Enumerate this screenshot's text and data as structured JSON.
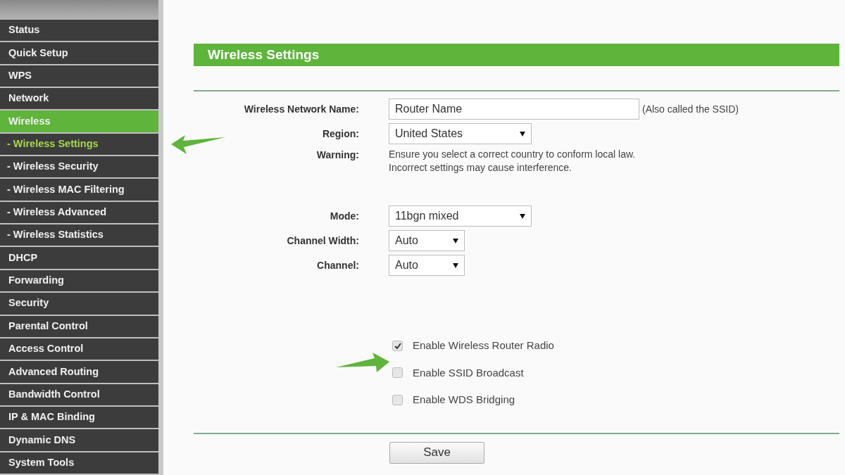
{
  "sidebar": {
    "items": [
      {
        "label": "Status",
        "kind": "main",
        "selected": false
      },
      {
        "label": "Quick Setup",
        "kind": "main",
        "selected": false
      },
      {
        "label": "WPS",
        "kind": "main",
        "selected": false
      },
      {
        "label": "Network",
        "kind": "main",
        "selected": false
      },
      {
        "label": "Wireless",
        "kind": "main",
        "selected": true
      },
      {
        "label": "- Wireless Settings",
        "kind": "sub",
        "selected": true
      },
      {
        "label": "- Wireless Security",
        "kind": "sub",
        "selected": false
      },
      {
        "label": "- Wireless MAC Filtering",
        "kind": "sub",
        "selected": false
      },
      {
        "label": "- Wireless Advanced",
        "kind": "sub",
        "selected": false
      },
      {
        "label": "- Wireless Statistics",
        "kind": "sub",
        "selected": false
      },
      {
        "label": "DHCP",
        "kind": "main",
        "selected": false
      },
      {
        "label": "Forwarding",
        "kind": "main",
        "selected": false
      },
      {
        "label": "Security",
        "kind": "main",
        "selected": false
      },
      {
        "label": "Parental Control",
        "kind": "main",
        "selected": false
      },
      {
        "label": "Access Control",
        "kind": "main",
        "selected": false
      },
      {
        "label": "Advanced Routing",
        "kind": "main",
        "selected": false
      },
      {
        "label": "Bandwidth Control",
        "kind": "main",
        "selected": false
      },
      {
        "label": "IP & MAC Binding",
        "kind": "main",
        "selected": false
      },
      {
        "label": "Dynamic DNS",
        "kind": "main",
        "selected": false
      },
      {
        "label": "System Tools",
        "kind": "main",
        "selected": false
      }
    ]
  },
  "header": {
    "title": "Wireless Settings"
  },
  "field_groups": [
    [
      {
        "kind": "text",
        "label": "Wireless Network Name:",
        "value": "Router Name",
        "note": "(Also called the SSID)"
      },
      {
        "kind": "select_wide",
        "label": "Region:",
        "value": "United States"
      },
      {
        "kind": "note",
        "label": "Warning:",
        "lines": [
          "Ensure you select a correct country to conform local law.",
          "Incorrect settings may cause interference."
        ]
      }
    ],
    [
      {
        "kind": "select_wide",
        "label": "Mode:",
        "value": "11bgn mixed"
      },
      {
        "kind": "select_narrow",
        "label": "Channel Width:",
        "value": "Auto"
      },
      {
        "kind": "select_narrow",
        "label": "Channel:",
        "value": "Auto"
      }
    ]
  ],
  "checkboxes": [
    {
      "label": "Enable Wireless Router Radio",
      "checked": true
    },
    {
      "label": "Enable SSID Broadcast",
      "checked": false
    },
    {
      "label": "Enable WDS Bridging",
      "checked": false
    }
  ],
  "save_button": {
    "label": "Save"
  }
}
